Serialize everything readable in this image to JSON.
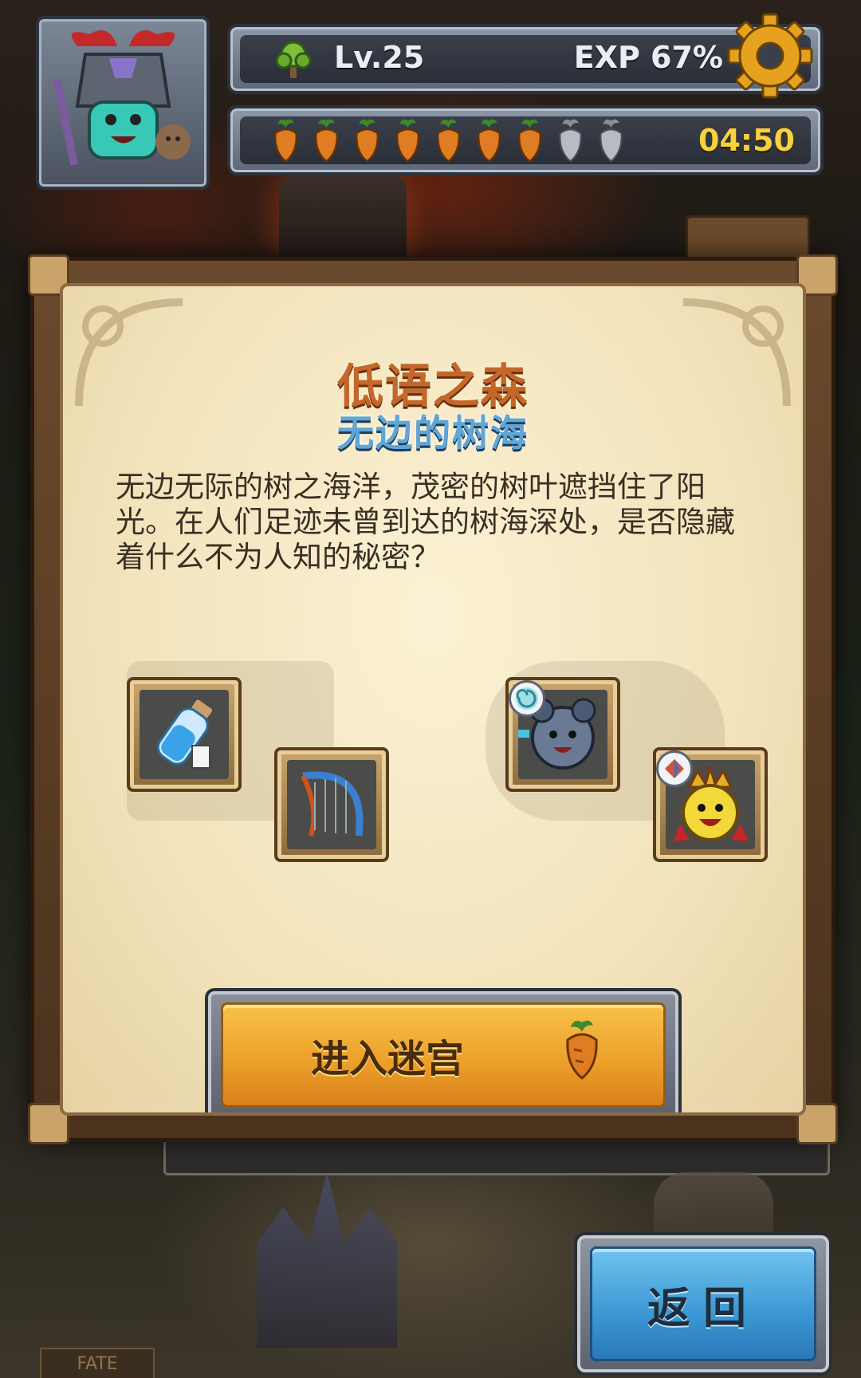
{
  "hud": {
    "level_label": "Lv.25",
    "exp_label": "EXP 67%",
    "exp_value": 0.67,
    "energy": {
      "filled": 7,
      "total": 9
    },
    "timer": "04:50",
    "icons": {
      "level": "tree-icon",
      "settings": "gear-icon",
      "energy": "carrot-icon"
    }
  },
  "panel": {
    "title": "低语之森",
    "subtitle": "无边的树海",
    "description": "无边无际的树之海洋，茂密的树叶遮挡住了阳光。在人们足迹未曾到达的树海深处，是否隐藏着什么不为人知的秘密？",
    "rewards": [
      {
        "icon": "potion-icon"
      },
      {
        "icon": "harp-bow-icon"
      },
      {
        "icon": "robot-monster-icon",
        "badge": "swirl-badge-icon"
      },
      {
        "icon": "king-monster-icon",
        "badge": "gem-badge-icon"
      }
    ],
    "enter_button": {
      "label": "进入迷宫",
      "cost_icon": "carrot-icon"
    }
  },
  "footer": {
    "back_label": "返回",
    "fate_tag": "FATE"
  },
  "colors": {
    "title": "#c3682a",
    "subtitle": "#5fa6d8",
    "enter_button": "#eda12a",
    "back_button": "#3b97d3",
    "timer": "#f7d23c"
  }
}
